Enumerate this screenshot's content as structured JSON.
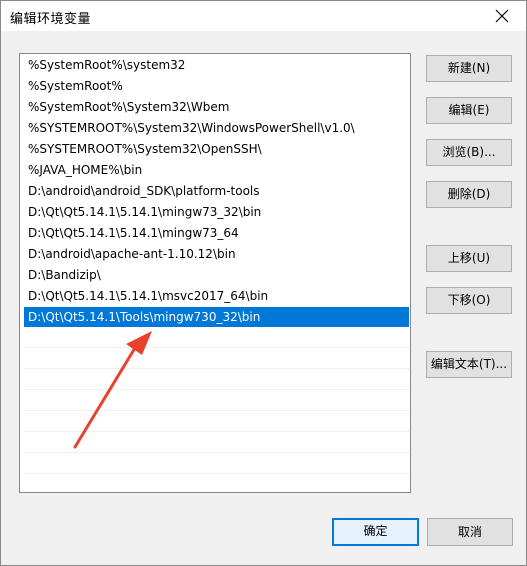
{
  "window": {
    "title": "编辑环境变量"
  },
  "paths": [
    "%SystemRoot%\\system32",
    "%SystemRoot%",
    "%SystemRoot%\\System32\\Wbem",
    "%SYSTEMROOT%\\System32\\WindowsPowerShell\\v1.0\\",
    "%SYSTEMROOT%\\System32\\OpenSSH\\",
    "%JAVA_HOME%\\bin",
    "D:\\android\\android_SDK\\platform-tools",
    "D:\\Qt\\Qt5.14.1\\5.14.1\\mingw73_32\\bin",
    "D:\\Qt\\Qt5.14.1\\5.14.1\\mingw73_64",
    "D:\\android\\apache-ant-1.10.12\\bin",
    "D:\\Bandizip\\",
    "D:\\Qt\\Qt5.14.1\\5.14.1\\msvc2017_64\\bin",
    "D:\\Qt\\Qt5.14.1\\Tools\\mingw730_32\\bin"
  ],
  "buttons": {
    "new": "新建(N)",
    "edit": "编辑(E)",
    "browse": "浏览(B)...",
    "delete": "删除(D)",
    "move_up": "上移(U)",
    "move_down": "下移(O)",
    "edit_text": "编辑文本(T)...",
    "ok": "确定",
    "cancel": "取消"
  },
  "colors": {
    "selection": "#0078d7",
    "annotation_arrow": "#e8412c"
  }
}
